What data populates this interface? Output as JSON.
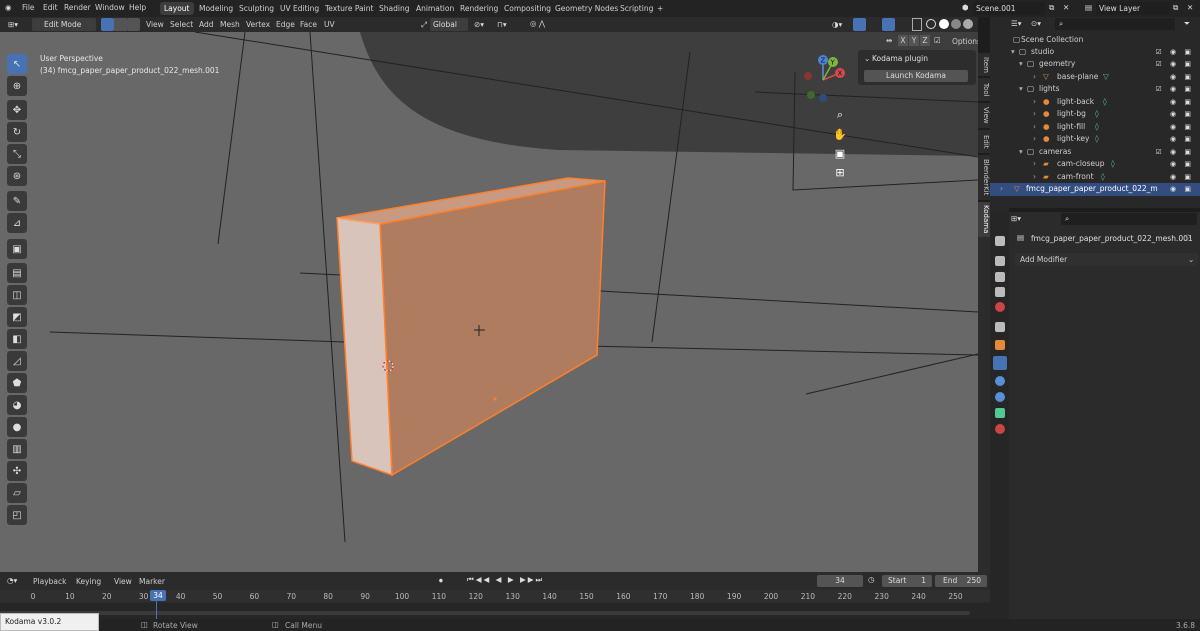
{
  "topbar": {
    "menus": [
      "File",
      "Edit",
      "Render",
      "Window",
      "Help"
    ],
    "workspaces": [
      "Layout",
      "Modeling",
      "Sculpting",
      "UV Editing",
      "Texture Paint",
      "Shading",
      "Animation",
      "Rendering",
      "Compositing",
      "Geometry Nodes",
      "Scripting"
    ],
    "active_workspace": "Layout",
    "add_tab": "+",
    "scene": "Scene.001",
    "view_layer": "View Layer"
  },
  "header": {
    "mode": "Edit Mode",
    "menus": [
      "View",
      "Select",
      "Add",
      "Mesh",
      "Vertex",
      "Edge",
      "Face",
      "UV"
    ],
    "orientation": "Global",
    "axes": [
      "X",
      "Y",
      "Z"
    ],
    "options": "Options"
  },
  "viewport": {
    "perspective": "User Perspective",
    "object": "(34) fmcg_paper_paper_product_022_mesh.001"
  },
  "gizmo": {
    "x": "X",
    "y": "Y",
    "z": "Z"
  },
  "npanel": {
    "title": "Kodama plugin",
    "launch": "Launch Kodama",
    "tabs": [
      "Item",
      "Tool",
      "View",
      "Edit",
      "BlenderKit",
      "Kodama"
    ],
    "active_tab": "Kodama"
  },
  "outliner": {
    "root": "Scene Collection",
    "items": [
      {
        "label": "studio"
      },
      {
        "label": "geometry"
      },
      {
        "label": "base-plane"
      },
      {
        "label": "lights"
      },
      {
        "label": "light-back"
      },
      {
        "label": "light-bg"
      },
      {
        "label": "light-fill"
      },
      {
        "label": "light-key"
      },
      {
        "label": "cameras"
      },
      {
        "label": "cam-closeup"
      },
      {
        "label": "cam-front"
      },
      {
        "label": "fmcg_paper_paper_product_022_m"
      }
    ]
  },
  "properties": {
    "object_name": "fmcg_paper_paper_product_022_mesh.001",
    "add_modifier": "Add Modifier"
  },
  "timeline": {
    "menus": [
      "Playback",
      "Keying",
      "View",
      "Marker"
    ],
    "current_frame": "34",
    "start_label": "Start",
    "start": "1",
    "end_label": "End",
    "end": "250",
    "ticks": [
      "0",
      "10",
      "20",
      "30",
      "40",
      "50",
      "60",
      "70",
      "80",
      "90",
      "100",
      "110",
      "120",
      "130",
      "140",
      "150",
      "160",
      "170",
      "180",
      "190",
      "200",
      "210",
      "220",
      "230",
      "240",
      "250"
    ],
    "playhead": "34"
  },
  "status": {
    "popup": "Kodama v3.0.2",
    "rotate": "Rotate View",
    "call_menu": "Call Menu",
    "version": "3.6.8"
  },
  "colors": {
    "selection": "#ff7f2a",
    "active_blue": "#4772b3",
    "viewport_bg": "#686868",
    "mesh_face": "#b07c60"
  }
}
